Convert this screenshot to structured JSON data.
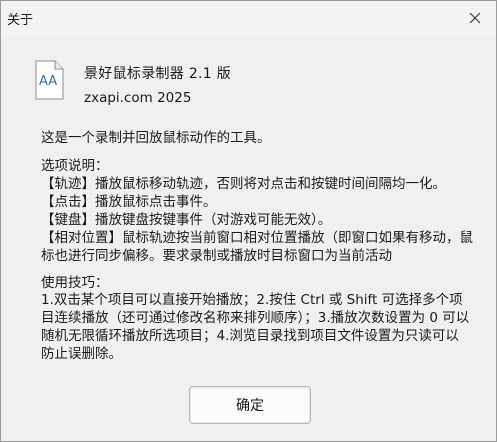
{
  "window": {
    "title": "关于",
    "close_icon": "close-icon"
  },
  "app": {
    "icon": "document-aa-icon",
    "icon_text": "AA",
    "name": "景好鼠标录制器  2.1 版",
    "site": "zxapi.com 2025"
  },
  "description": "这是一个录制并回放鼠标动作的工具。",
  "options": {
    "title": "选项说明：",
    "lines": [
      "【轨迹】播放鼠标移动轨迹，否则将对点击和按键时间间隔均一化。",
      "【点击】播放鼠标点击事件。",
      "【键盘】播放键盘按键事件（对游戏可能无效）。",
      "【相对位置】鼠标轨迹按当前窗口相对位置播放（即窗口如果有移动，鼠标也进行同步偏移。要求录制或播放时目标窗口为当前活动"
    ]
  },
  "tips": {
    "title": "使用技巧：",
    "body": "1.双击某个项目可以直接开始播放；2.按住 Ctrl 或 Shift 可选择多个项目连续播放（还可通过修改名称来排列顺序）；3.播放次数设置为 0 可以随机无限循环播放所选项目；4.浏览目录找到项目文件设置为只读可以防止误删除。"
  },
  "buttons": {
    "ok": "确定"
  }
}
